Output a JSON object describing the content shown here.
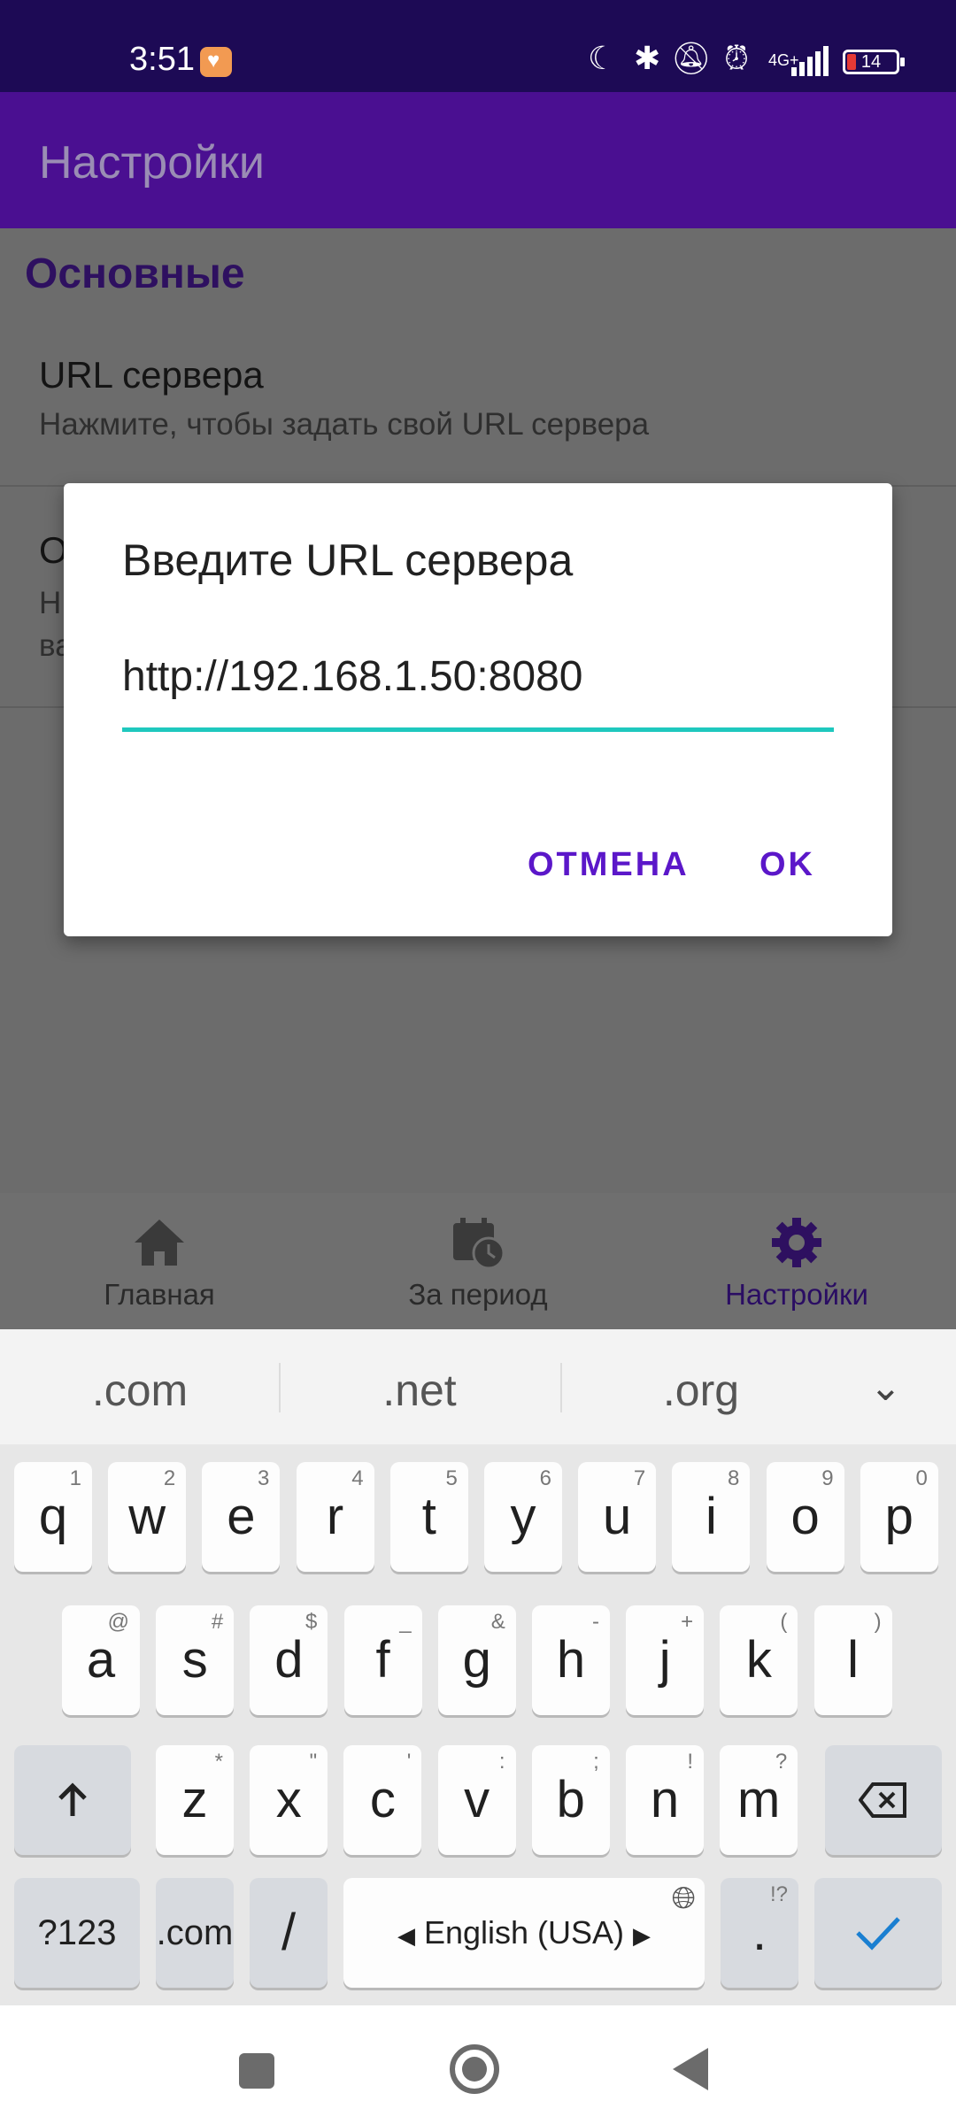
{
  "status_bar": {
    "time": "3:51",
    "network": "4G+",
    "battery": "14"
  },
  "app_bar": {
    "title": "Настройки"
  },
  "settings": {
    "section_title": "Основные",
    "items": [
      {
        "title": "URL сервера",
        "summary": "Нажмите, чтобы задать свой URL сервера"
      },
      {
        "title_partial": "О",
        "summary_partial_1": "Н",
        "summary_partial_2": "ва"
      }
    ]
  },
  "bottom_nav": {
    "items": [
      {
        "label": "Главная",
        "icon": "home-icon"
      },
      {
        "label": "За период",
        "icon": "calendar-clock-icon"
      },
      {
        "label": "Настройки",
        "icon": "gear-icon"
      }
    ],
    "active": "Настройки"
  },
  "dialog": {
    "title": "Введите URL сервера",
    "input_value": "http://192.168.1.50:8080",
    "cancel_label": "ОТМЕНА",
    "ok_label": "OK"
  },
  "keyboard": {
    "suggestions": [
      ".com",
      ".net",
      ".org"
    ],
    "row1": [
      {
        "key": "q",
        "hint": "1"
      },
      {
        "key": "w",
        "hint": "2"
      },
      {
        "key": "e",
        "hint": "3"
      },
      {
        "key": "r",
        "hint": "4"
      },
      {
        "key": "t",
        "hint": "5"
      },
      {
        "key": "y",
        "hint": "6"
      },
      {
        "key": "u",
        "hint": "7"
      },
      {
        "key": "i",
        "hint": "8"
      },
      {
        "key": "o",
        "hint": "9"
      },
      {
        "key": "p",
        "hint": "0"
      }
    ],
    "row2": [
      {
        "key": "a",
        "hint": "@"
      },
      {
        "key": "s",
        "hint": "#"
      },
      {
        "key": "d",
        "hint": "$"
      },
      {
        "key": "f",
        "hint": "_"
      },
      {
        "key": "g",
        "hint": "&"
      },
      {
        "key": "h",
        "hint": "-"
      },
      {
        "key": "j",
        "hint": "+"
      },
      {
        "key": "k",
        "hint": "("
      },
      {
        "key": "l",
        "hint": ")"
      }
    ],
    "row3": [
      {
        "key": "z",
        "hint": "*"
      },
      {
        "key": "x",
        "hint": "\""
      },
      {
        "key": "c",
        "hint": "'"
      },
      {
        "key": "v",
        "hint": ":"
      },
      {
        "key": "b",
        "hint": ";"
      },
      {
        "key": "n",
        "hint": "!"
      },
      {
        "key": "m",
        "hint": "?"
      }
    ],
    "symbols_label": "?123",
    "com_label": ".com",
    "slash_label": "/",
    "space_label": "English (USA)",
    "period_label": ".",
    "period_hint": "!?"
  }
}
